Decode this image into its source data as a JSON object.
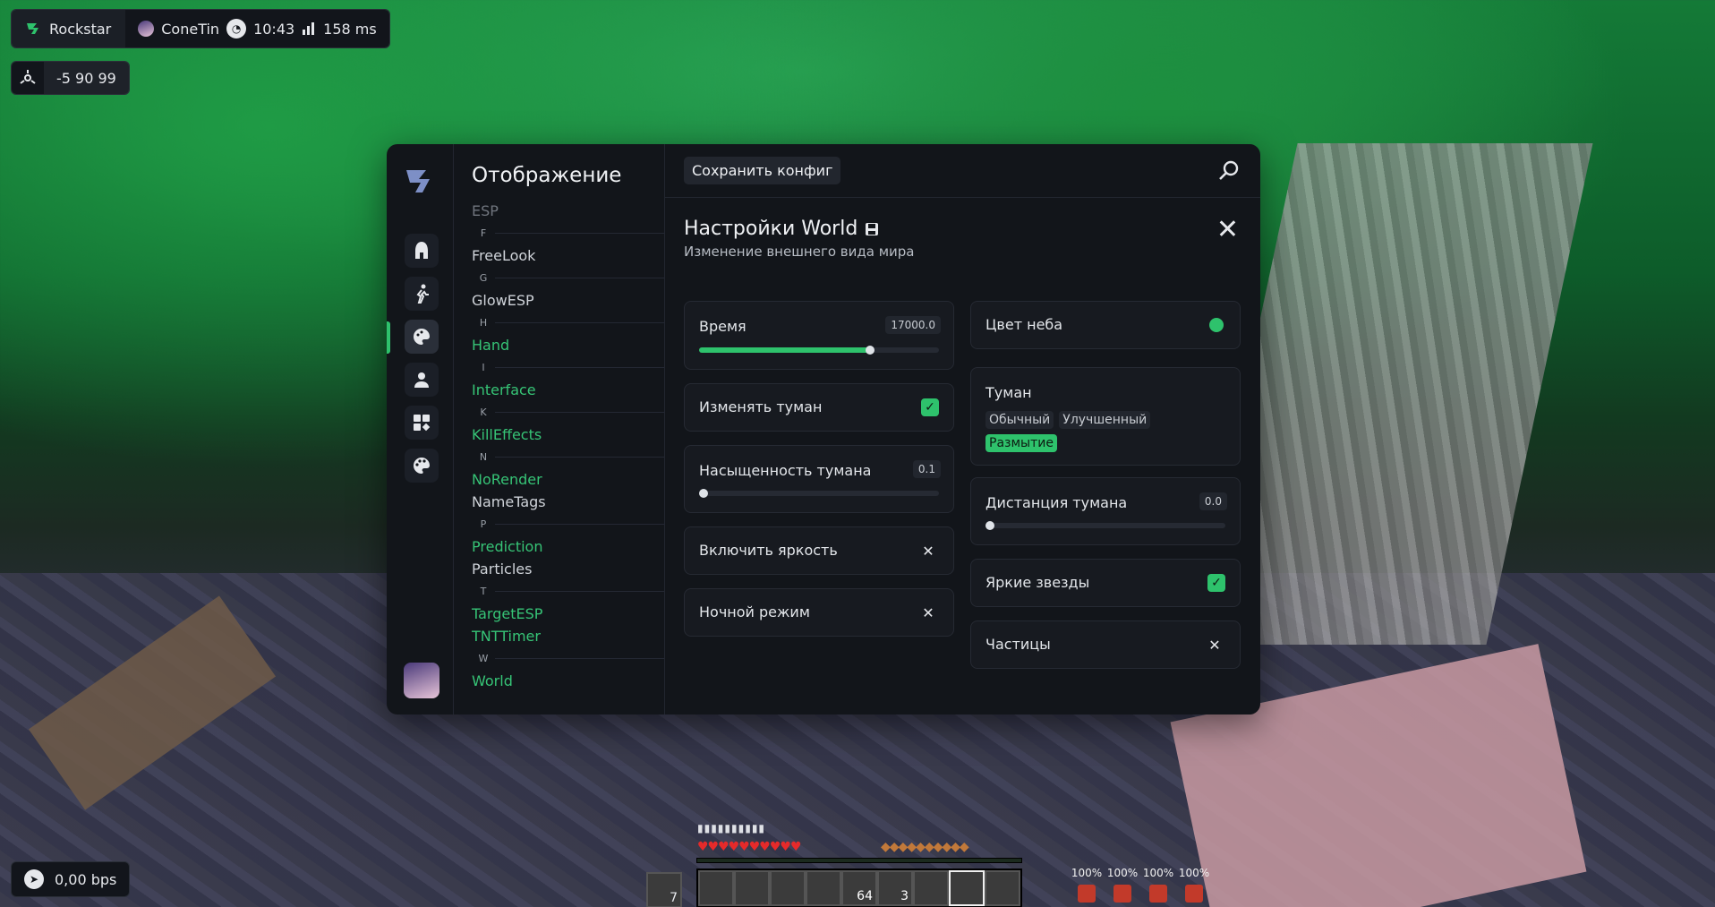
{
  "hud": {
    "brand": "Rockstar",
    "user": "ConeTin",
    "time": "10:43",
    "ping": "158 ms",
    "coords": "-5 90 99",
    "bps": "0,00 bps"
  },
  "panel": {
    "category_title": "Отображение",
    "modules": [
      {
        "type": "mod",
        "label": "ESP",
        "state": "dim"
      },
      {
        "type": "letter",
        "label": "F"
      },
      {
        "type": "mod",
        "label": "FreeLook",
        "state": "off"
      },
      {
        "type": "letter",
        "label": "G"
      },
      {
        "type": "mod",
        "label": "GlowESP",
        "state": "off"
      },
      {
        "type": "letter",
        "label": "H"
      },
      {
        "type": "mod",
        "label": "Hand",
        "state": "on"
      },
      {
        "type": "letter",
        "label": "I"
      },
      {
        "type": "mod",
        "label": "Interface",
        "state": "on"
      },
      {
        "type": "letter",
        "label": "K"
      },
      {
        "type": "mod",
        "label": "KillEffects",
        "state": "on"
      },
      {
        "type": "letter",
        "label": "N"
      },
      {
        "type": "mod",
        "label": "NoRender",
        "state": "on"
      },
      {
        "type": "mod",
        "label": "NameTags",
        "state": "off"
      },
      {
        "type": "letter",
        "label": "P"
      },
      {
        "type": "mod",
        "label": "Prediction",
        "state": "on"
      },
      {
        "type": "mod",
        "label": "Particles",
        "state": "off"
      },
      {
        "type": "letter",
        "label": "T"
      },
      {
        "type": "mod",
        "label": "TargetESP",
        "state": "on"
      },
      {
        "type": "mod",
        "label": "TNTTimer",
        "state": "on"
      },
      {
        "type": "letter",
        "label": "W"
      },
      {
        "type": "mod",
        "label": "World",
        "state": "on"
      }
    ],
    "save_label": "Сохранить конфиг",
    "settings_title": "Настройки World",
    "settings_subtitle": "Изменение внешнего вида мира",
    "left": {
      "time": {
        "label": "Время",
        "value": "17000.0",
        "fraction": 0.71
      },
      "change_fog": {
        "label": "Изменять туман",
        "checked": true
      },
      "fog_saturation": {
        "label": "Насыщенность тумана",
        "value": "0.1",
        "fraction": 0.0
      },
      "brightness": {
        "label": "Включить яркость",
        "checked": false
      },
      "night_mode": {
        "label": "Ночной режим",
        "checked": false
      }
    },
    "right": {
      "sky_color": {
        "label": "Цвет неба",
        "color": "#2ec26c"
      },
      "fog": {
        "label": "Туман",
        "options": [
          "Обычный",
          "Улучшенный",
          "Размытие"
        ],
        "selected": "Размытие"
      },
      "fog_distance": {
        "label": "Дистанция тумана",
        "value": "0.0",
        "fraction": 0.0
      },
      "bright_stars": {
        "label": "Яркие звезды",
        "checked": true
      },
      "particles": {
        "label": "Частицы",
        "checked": false
      }
    }
  },
  "hotbar": {
    "offhand_count": "7",
    "stack_count": "64",
    "bucket_count": "3",
    "durability": [
      "100%",
      "100%",
      "100%",
      "100%"
    ]
  },
  "colors": {
    "accent": "#2ec26c",
    "panel": "#12151a",
    "card": "#171a20"
  }
}
